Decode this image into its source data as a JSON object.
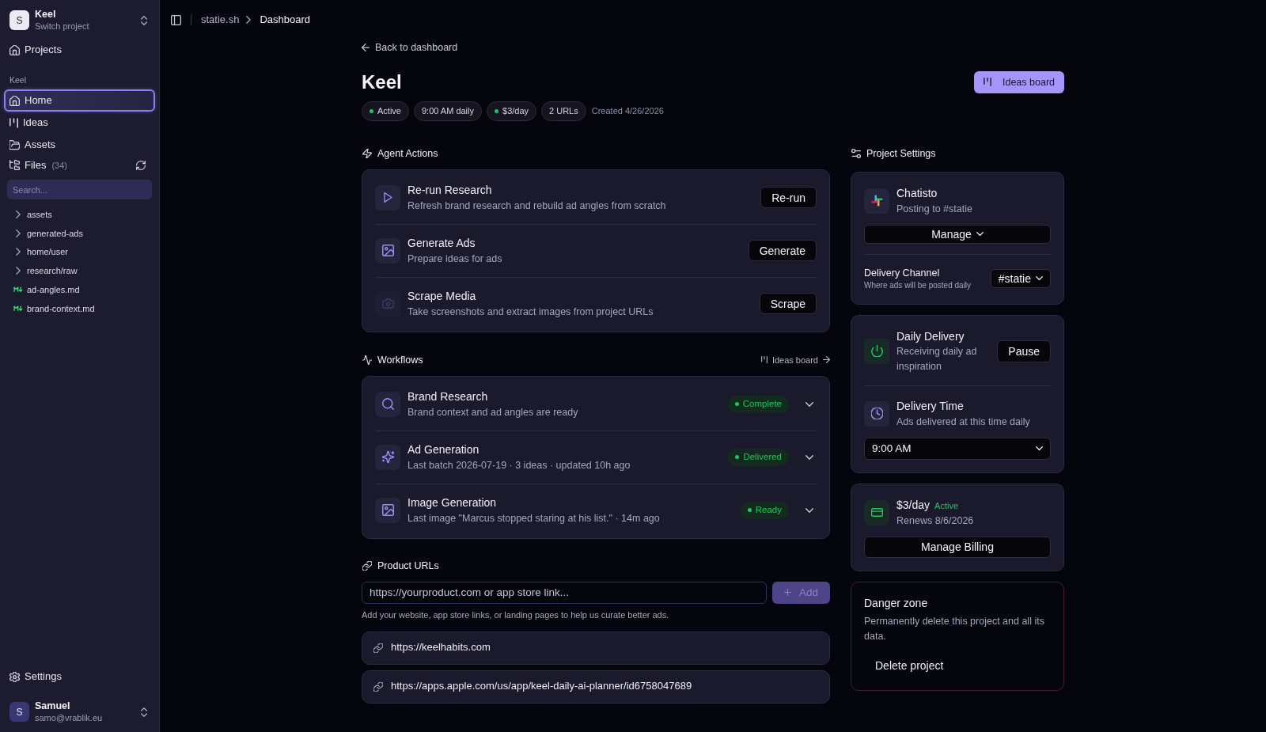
{
  "sidebar": {
    "project": {
      "avatar": "S",
      "name": "Keel",
      "subtitle": "Switch project"
    },
    "top_links": [
      {
        "label": "Projects"
      }
    ],
    "section_label": "Keel",
    "nav": [
      {
        "label": "Home",
        "selected": true
      },
      {
        "label": "Ideas",
        "selected": false
      },
      {
        "label": "Assets",
        "selected": false
      }
    ],
    "files": {
      "label": "Files",
      "count": "(34)"
    },
    "search": {
      "placeholder": "Search..."
    },
    "tree": [
      {
        "kind": "folder",
        "label": "assets"
      },
      {
        "kind": "folder",
        "label": "generated-ads"
      },
      {
        "kind": "folder",
        "label": "home/user"
      },
      {
        "kind": "folder",
        "label": "research/raw"
      },
      {
        "kind": "markdown",
        "label": "ad-angles.md"
      },
      {
        "kind": "markdown",
        "label": "brand-context.md"
      }
    ],
    "footer_links": [
      {
        "label": "Settings"
      }
    ],
    "user": {
      "avatar": "S",
      "name": "Samuel",
      "email": "samo@vrablik.eu"
    }
  },
  "breadcrumbs": [
    "statie.sh",
    "Dashboard"
  ],
  "page": {
    "back_link": "Back to dashboard",
    "title": "Keel",
    "ideas_button": "Ideas board",
    "badges": [
      {
        "kind": "status",
        "label": "Active"
      },
      {
        "kind": "plain",
        "label": "9:00 AM daily"
      },
      {
        "kind": "status",
        "label": "$3/day"
      },
      {
        "kind": "plain",
        "label": "2 URLs"
      }
    ],
    "created": "Created 4/26/2026"
  },
  "agent_actions": {
    "title": "Agent Actions",
    "items": [
      {
        "title": "Re-run Research",
        "description": "Refresh brand research and rebuild ad angles from scratch",
        "button": "Re-run"
      },
      {
        "title": "Generate Ads",
        "description": "Prepare ideas for ads",
        "button": "Generate"
      },
      {
        "title": "Scrape Media",
        "description": "Take screenshots and extract images from project URLs",
        "button": "Scrape"
      }
    ]
  },
  "workflows": {
    "title": "Workflows",
    "link": "Ideas board",
    "items": [
      {
        "title": "Brand Research",
        "description": "Brand context and ad angles are ready",
        "status": "Complete",
        "expanded": false
      },
      {
        "title": "Ad Generation",
        "description": "Last batch 2026-07-19 · 3 ideas · updated 10h ago",
        "status": "Delivered",
        "expanded": false
      },
      {
        "title": "Image Generation",
        "description": "Last image \"Marcus stopped staring at his list.\" · 14m ago",
        "status": "Ready",
        "expanded": false
      }
    ]
  },
  "product_urls": {
    "title": "Product URLs",
    "input": {
      "placeholder": "https://yourproduct.com or app store link..."
    },
    "add_button": {
      "label": "Add",
      "disabled": true
    },
    "help": "Add your website, app store links, or landing pages to help us curate better ads.",
    "urls": [
      "https://keelhabits.com",
      "https://apps.apple.com/us/app/keel-daily-ai-planner/id6758047689"
    ]
  },
  "project_settings": {
    "title": "Project Settings",
    "integration": {
      "name": "Chatisto",
      "subtitle": "Posting to #statie",
      "button": "Manage"
    },
    "delivery_channel": {
      "label": "Delivery Channel",
      "hint": "Where ads will be posted daily",
      "value": "#statie"
    },
    "daily_delivery": {
      "title": "Daily Delivery",
      "description": "Receiving daily ad inspiration",
      "button": "Pause"
    },
    "delivery_time": {
      "title": "Delivery Time",
      "description": "Ads delivered at this time daily",
      "value": "9:00 AM"
    },
    "billing": {
      "plan": "$3/day",
      "status": "Active",
      "renews": "Renews 8/6/2026",
      "button": "Manage Billing"
    },
    "danger_zone": {
      "title": "Danger zone",
      "description": "Permanently delete this project and all its data.",
      "button": "Delete project"
    }
  }
}
